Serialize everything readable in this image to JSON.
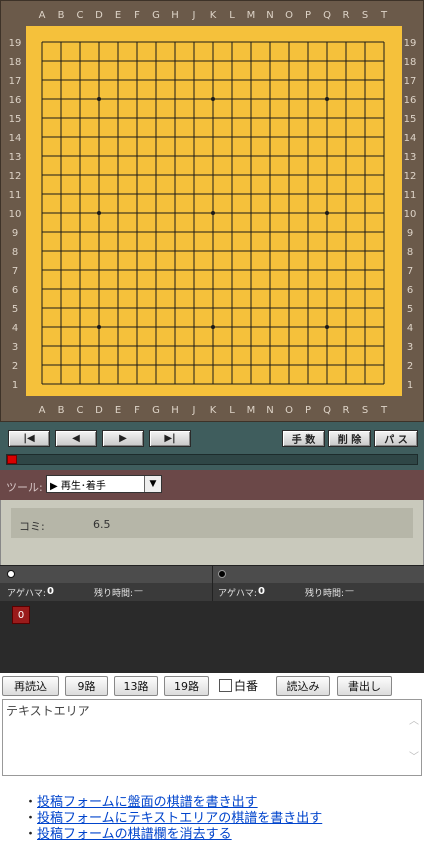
{
  "board": {
    "size": 19,
    "col_labels": [
      "A",
      "B",
      "C",
      "D",
      "E",
      "F",
      "G",
      "H",
      "J",
      "K",
      "L",
      "M",
      "N",
      "O",
      "P",
      "Q",
      "R",
      "S",
      "T"
    ],
    "row_labels": [
      "19",
      "18",
      "17",
      "16",
      "15",
      "14",
      "13",
      "12",
      "11",
      "10",
      "9",
      "8",
      "7",
      "6",
      "5",
      "4",
      "3",
      "2",
      "1"
    ],
    "star_points": [
      [
        "D",
        16
      ],
      [
        "K",
        16
      ],
      [
        "Q",
        16
      ],
      [
        "D",
        10
      ],
      [
        "K",
        10
      ],
      [
        "Q",
        10
      ],
      [
        "D",
        4
      ],
      [
        "K",
        4
      ],
      [
        "Q",
        4
      ]
    ],
    "colors": {
      "frame": "#6b5a4a",
      "wood": "#f5c13b",
      "grid": "#1a1a1a",
      "coord": "#ded4c8"
    }
  },
  "navigation": {
    "buttons": [
      {
        "name": "first-move-button",
        "icon": "first-icon",
        "glyph": "|◀"
      },
      {
        "name": "prev-move-button",
        "icon": "prev-icon",
        "glyph": "◀"
      },
      {
        "name": "next-move-button",
        "icon": "next-icon",
        "glyph": "▶"
      },
      {
        "name": "last-move-button",
        "icon": "last-icon",
        "glyph": "▶|"
      }
    ],
    "move_count_label": "手 数",
    "delete_label": "削 除",
    "pass_label": "パ ス",
    "progress": 0
  },
  "tool": {
    "label": "ツール:",
    "selected": "▶ 再生･着手"
  },
  "komi": {
    "label": "コミ:",
    "value": "6.5"
  },
  "players": {
    "white": {
      "captures_label": "アゲハマ:",
      "captures": "0",
      "time_label": "残り時間:",
      "time": "—"
    },
    "black": {
      "captures_label": "アゲハマ:",
      "captures": "0",
      "time_label": "残り時間:",
      "time": "—"
    }
  },
  "moves": {
    "current": "0"
  },
  "toolbar": {
    "reload_label": "再読込",
    "size9_label": "9路",
    "size13_label": "13路",
    "size19_label": "19路",
    "white_turn_label": "白番",
    "load_label": "読込み",
    "export_label": "書出し"
  },
  "textarea": {
    "value": "テキストエリア"
  },
  "links": [
    {
      "text": "投稿フォームに盤面の棋譜を書き出す"
    },
    {
      "text": "投稿フォームにテキストエリアの棋譜を書き出す"
    },
    {
      "text": "投稿フォームの棋譜欄を消去する"
    }
  ]
}
